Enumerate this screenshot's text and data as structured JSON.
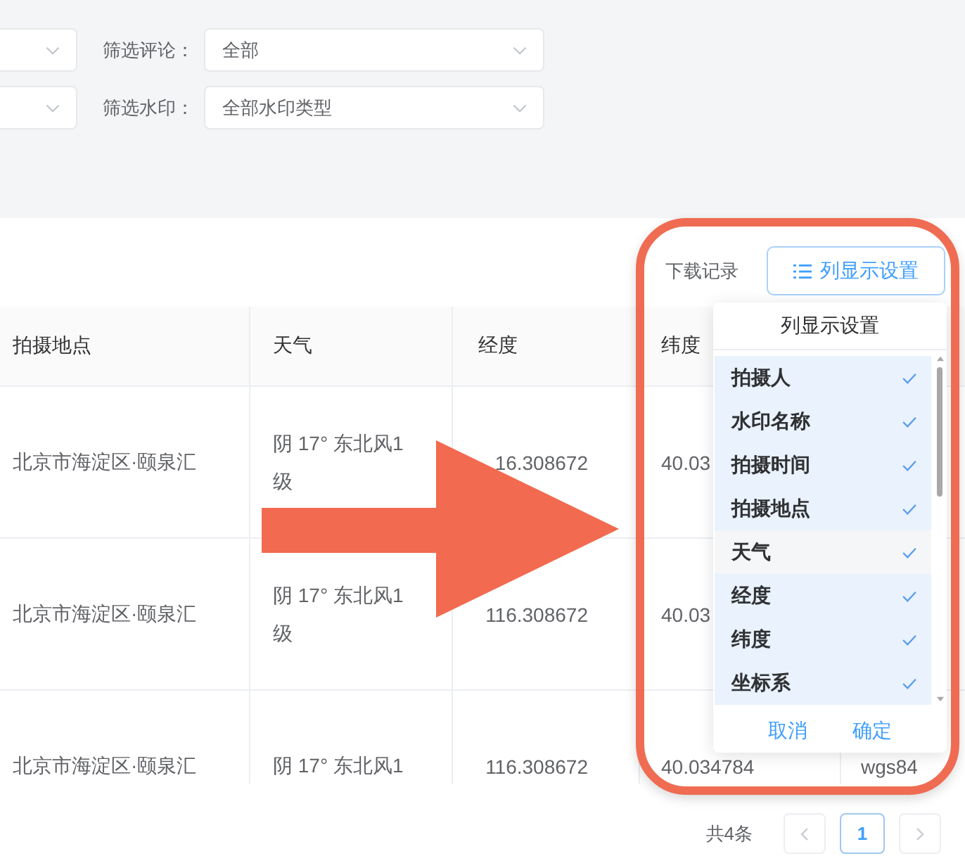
{
  "filters": [
    {
      "label": "筛选评论：",
      "value": "全部"
    },
    {
      "label": "筛选水印：",
      "value": "全部水印类型"
    }
  ],
  "toolbar": {
    "link": "下载记录",
    "column_button": "列显示设置"
  },
  "table": {
    "columns": [
      "拍摄地点",
      "天气",
      "经度",
      "纬度"
    ],
    "rows": [
      [
        "北京市海淀区·颐泉汇",
        "阴 17° 东北风1级",
        "16.308672",
        "40.03"
      ],
      [
        "北京市海淀区·颐泉汇",
        "阴 17° 东北风1级",
        "116.308672",
        "40.03"
      ],
      [
        "北京市海淀区·颐泉汇",
        "阴 17° 东北风1",
        "116.308672",
        "40.034784",
        "wgs84"
      ]
    ]
  },
  "column_settings": {
    "title": "列显示设置",
    "items": [
      {
        "label": "拍摄人",
        "selected": true,
        "hovered": false
      },
      {
        "label": "水印名称",
        "selected": true,
        "hovered": false
      },
      {
        "label": "拍摄时间",
        "selected": true,
        "hovered": false
      },
      {
        "label": "拍摄地点",
        "selected": true,
        "hovered": false
      },
      {
        "label": "天气",
        "selected": true,
        "hovered": true
      },
      {
        "label": "经度",
        "selected": true,
        "hovered": false
      },
      {
        "label": "纬度",
        "selected": true,
        "hovered": false
      },
      {
        "label": "坐标系",
        "selected": true,
        "hovered": false
      }
    ],
    "buttons": [
      "取消",
      "确定"
    ]
  },
  "pagination": {
    "total": "共4条",
    "prev": {
      "disabled": true
    },
    "pages": [
      {
        "label": "1",
        "selected": true
      }
    ],
    "next": {
      "disabled": true
    }
  }
}
